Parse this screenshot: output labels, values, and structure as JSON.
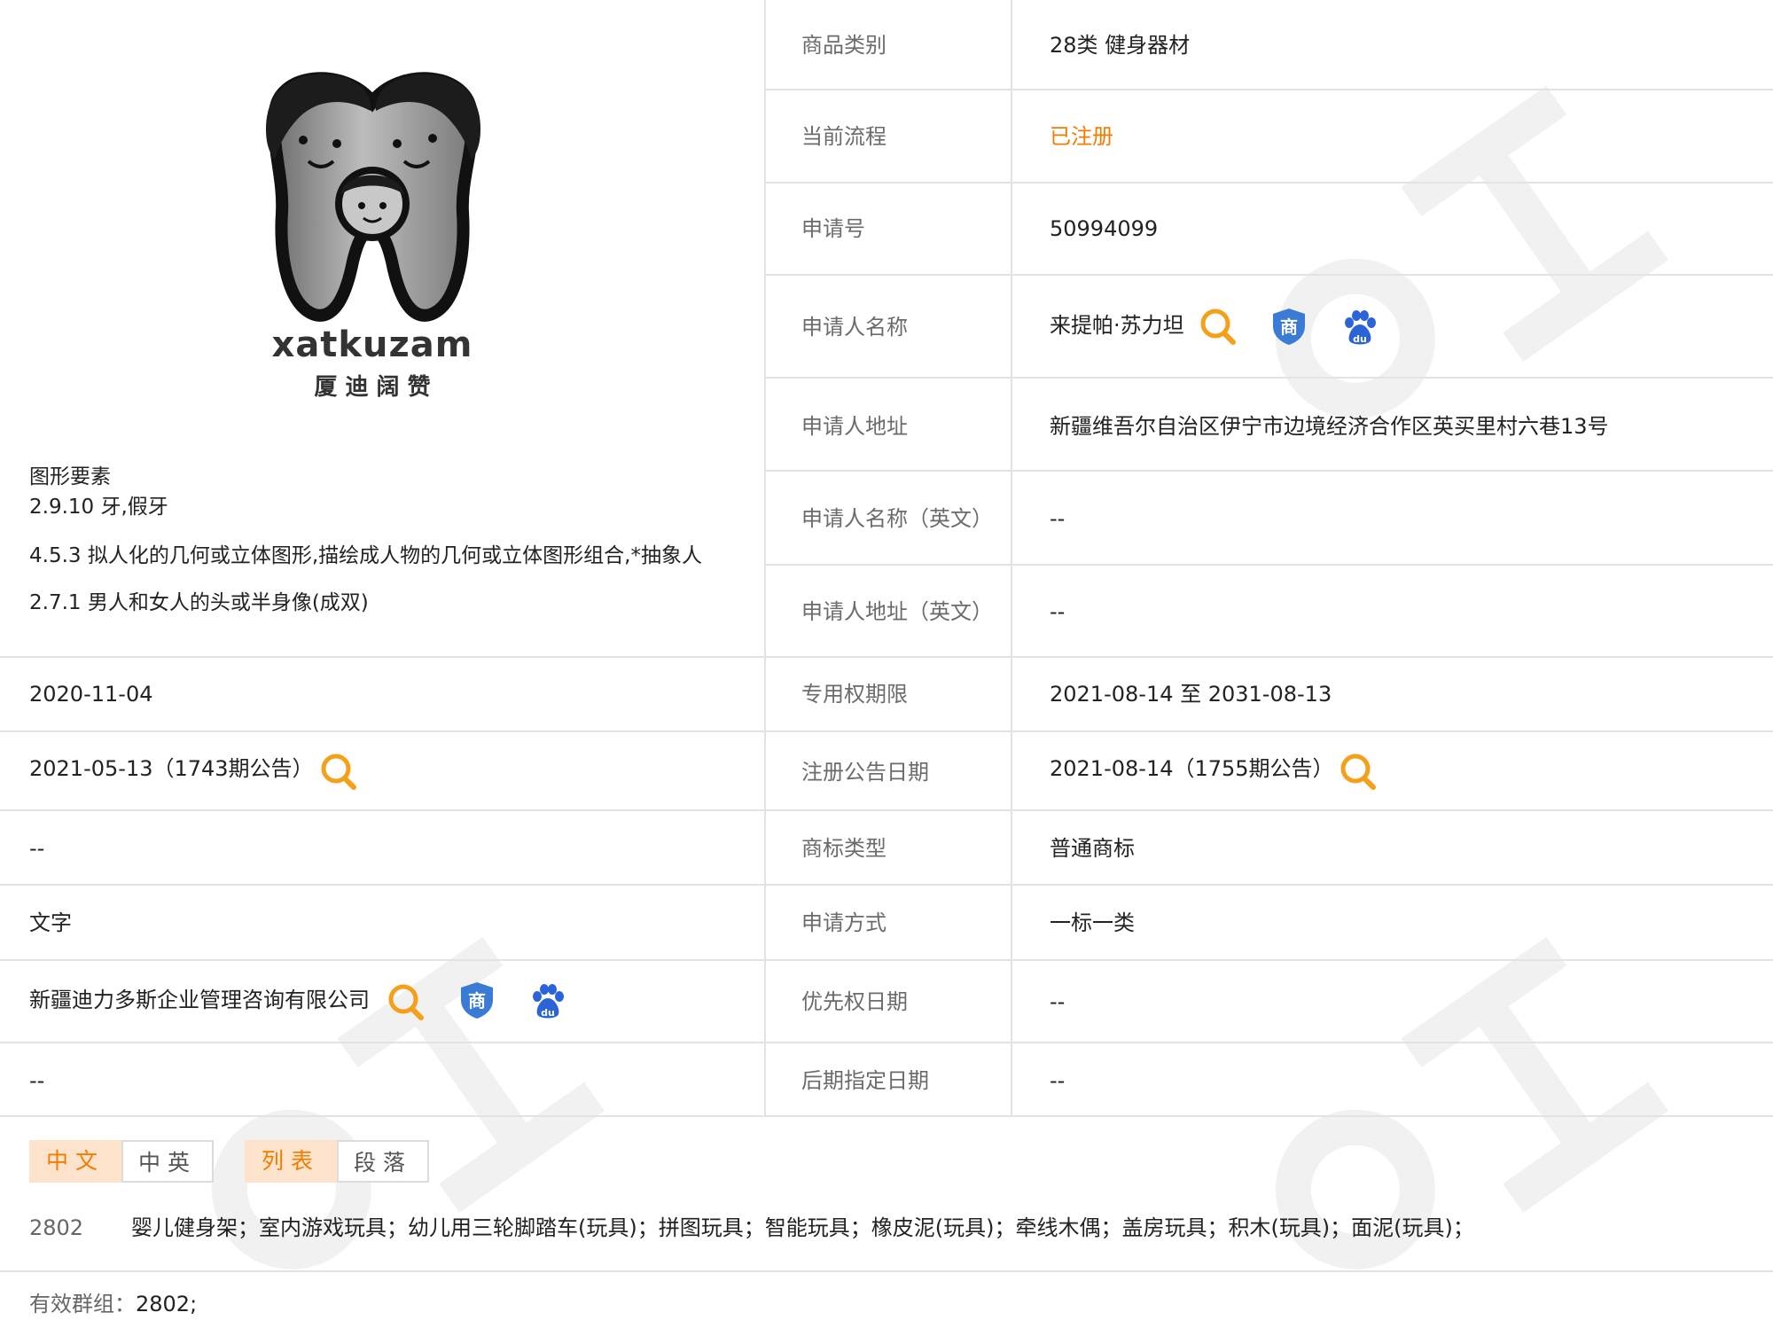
{
  "logo": {
    "brand_text": "xatkuzam",
    "brand_cn": "厦 迪 阔 赞"
  },
  "figure_elements": {
    "title": "图形要素",
    "items": [
      "2.9.10 牙,假牙",
      "4.5.3 拟人化的几何或立体图形,描绘成人物的几何或立体图形组合,*抽象人",
      "2.7.1 男人和女人的头或半身像(成双)"
    ]
  },
  "details": [
    {
      "label": "商品类别",
      "value": "28类 健身器材"
    },
    {
      "label": "当前流程",
      "value": "已注册"
    },
    {
      "label": "申请号",
      "value": "50994099"
    },
    {
      "label": "申请人名称",
      "value": "来提帕·苏力坦"
    },
    {
      "label": "申请人地址",
      "value": "新疆维吾尔自治区伊宁市边境经济合作区英买里村六巷13号"
    },
    {
      "label": "申请人名称（英文）",
      "value": "--"
    },
    {
      "label": "申请人地址（英文）",
      "value": "--"
    },
    {
      "label": "专用权期限",
      "value": "2021-08-14 至 2031-08-13"
    },
    {
      "label": "注册公告日期",
      "value": "2021-08-14（1755期公告）"
    },
    {
      "label": "商标类型",
      "value": "普通商标"
    },
    {
      "label": "申请方式",
      "value": "一标一类"
    },
    {
      "label": "优先权日期",
      "value": "--"
    },
    {
      "label": "后期指定日期",
      "value": "--"
    }
  ],
  "left_values": [
    "2020-11-04",
    "2021-05-13（1743期公告）",
    "--",
    "文字",
    "新疆迪力多斯企业管理咨询有限公司",
    "--"
  ],
  "tabs": {
    "lang": [
      "中文",
      "中英"
    ],
    "view": [
      "列表",
      "段落"
    ]
  },
  "goods": {
    "code": "2802",
    "items": "婴儿健身架；室内游戏玩具；幼儿用三轮脚踏车(玩具)；拼图玩具；智能玩具；橡皮泥(玩具)；牵线木偶；盖房玩具；积木(玩具)；面泥(玩具)；"
  },
  "valid_group": {
    "label": "有效群组：",
    "value": "2802;"
  },
  "icons": {
    "search": "search-icon",
    "trademark": "trademark-shield-icon",
    "baidu": "baidu-paw-icon",
    "shield_char": "商",
    "baidu_text": "du"
  },
  "colors": {
    "accent": "#f07d00",
    "shield": "#3a7bd5",
    "baidu": "#2b63d9"
  }
}
